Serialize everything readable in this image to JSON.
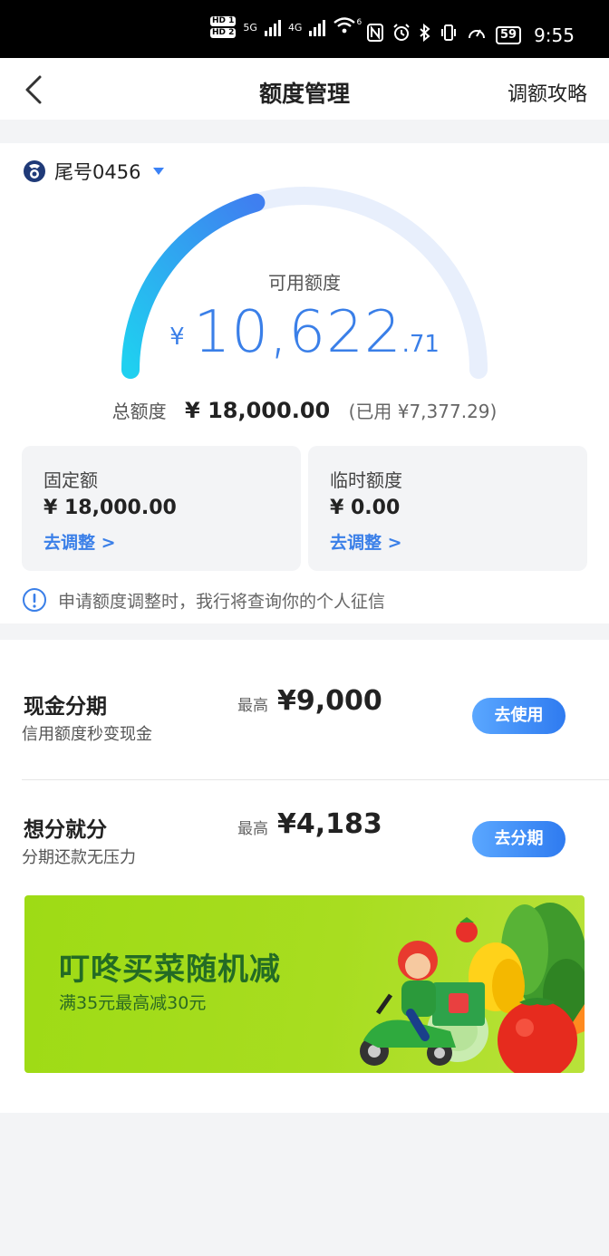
{
  "status_bar": {
    "hd1": "HD 1",
    "hd2": "HD 2",
    "net1": "5G",
    "net2": "4G",
    "wifi_tag": "6",
    "battery": "59",
    "time": "9:55"
  },
  "nav": {
    "title": "额度管理",
    "right_action": "调额攻略"
  },
  "card": {
    "label": "尾号0456"
  },
  "available": {
    "label": "可用额度",
    "currency": "¥",
    "integer_part": "10,622",
    "decimal_part": ".71",
    "usage_fraction": 0.41
  },
  "total": {
    "label": "总额度",
    "value": "¥ 18,000.00",
    "used": "(已用 ¥7,377.29)"
  },
  "limits": [
    {
      "title": "固定额",
      "value": "¥ 18,000.00",
      "link": "去调整 >"
    },
    {
      "title": "临时额度",
      "value": "¥ 0.00",
      "link": "去调整 >"
    }
  ],
  "notice": {
    "text": "申请额度调整时，我行将查询你的个人征信"
  },
  "products": [
    {
      "title": "现金分期",
      "subtitle": "信用额度秒变现金",
      "max_label": "最高",
      "amount": "¥9,000",
      "button": "去使用"
    },
    {
      "title": "想分就分",
      "subtitle": "分期还款无压力",
      "max_label": "最高",
      "amount": "¥4,183",
      "button": "去分期"
    }
  ],
  "banner": {
    "title": "叮咚买菜随机减",
    "subtitle": "满35元最高减30元"
  },
  "colors": {
    "accent": "#3a7fe8",
    "gauge_start": "#1fd0f0",
    "gauge_end": "#3f7ff0",
    "gauge_track": "#e8effc",
    "banner_green": "#a4dc1c"
  }
}
